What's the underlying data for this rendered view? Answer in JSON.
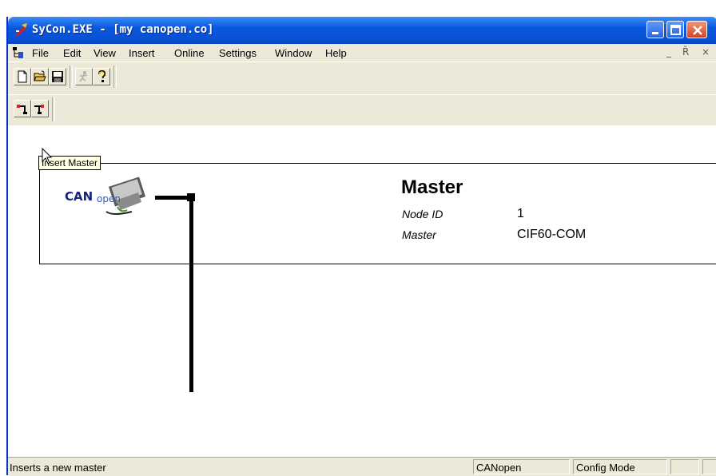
{
  "window": {
    "title": "SyCon.EXE - [my canopen.co]",
    "controls": {
      "minimize_icon": "minimize-icon",
      "maximize_icon": "maximize-icon",
      "close_icon": "close-icon"
    }
  },
  "menu": {
    "items": [
      "File",
      "Edit",
      "View",
      "Insert",
      "Online",
      "Settings",
      "Window",
      "Help"
    ],
    "mdi_controls": [
      "_",
      "Ř",
      "×"
    ]
  },
  "toolbar1": {
    "buttons": [
      "new-document-icon",
      "open-folder-icon",
      "save-disk-icon",
      "run-figure-icon",
      "help-question-icon"
    ]
  },
  "toolbar2": {
    "buttons": [
      "insert-master-icon",
      "insert-slave-icon"
    ]
  },
  "tooltip": {
    "text": "Insert Master"
  },
  "master": {
    "title": "Master",
    "logo_text": "CANopen",
    "properties": [
      {
        "label": "Node ID",
        "value": "1"
      },
      {
        "label": "Master",
        "value": "CIF60-COM"
      }
    ]
  },
  "statusbar": {
    "message": "Inserts a new master",
    "protocol": "CANopen",
    "mode": "Config Mode"
  },
  "colors": {
    "titlebar": "#0a58e0",
    "chrome": "#ece9d8",
    "tooltip_bg": "#ffffe1",
    "close_button": "#d4411e"
  }
}
